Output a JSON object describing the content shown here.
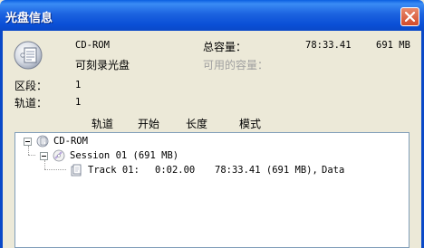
{
  "window": {
    "title": "光盘信息"
  },
  "info": {
    "disc_type": "CD-ROM",
    "disc_status": "可刻录光盘",
    "total_capacity_label": "总容量：",
    "total_capacity_time": "78:33.41",
    "total_capacity_size": "691 MB",
    "available_capacity_label": "可用的容量："
  },
  "stats": {
    "sessions_label": "区段：",
    "sessions_value": "1",
    "tracks_label": "轨道：",
    "tracks_value": "1"
  },
  "columns": [
    "轨道",
    "开始",
    "长度",
    "模式"
  ],
  "tree": {
    "root": "CD-ROM",
    "session": "Session 01 (691 MB)",
    "track_name": "Track 01:",
    "track_start": "0:02.00",
    "track_length": "78:33.41 (691 MB),",
    "track_mode": "Data"
  },
  "colors": {
    "titlebar": "#0a5ee0",
    "window_bg": "#ece9d8",
    "close_button": "#d24a2a"
  },
  "icons": [
    "disc-icon",
    "close-icon",
    "cd-icon",
    "session-icon",
    "track-icon"
  ]
}
